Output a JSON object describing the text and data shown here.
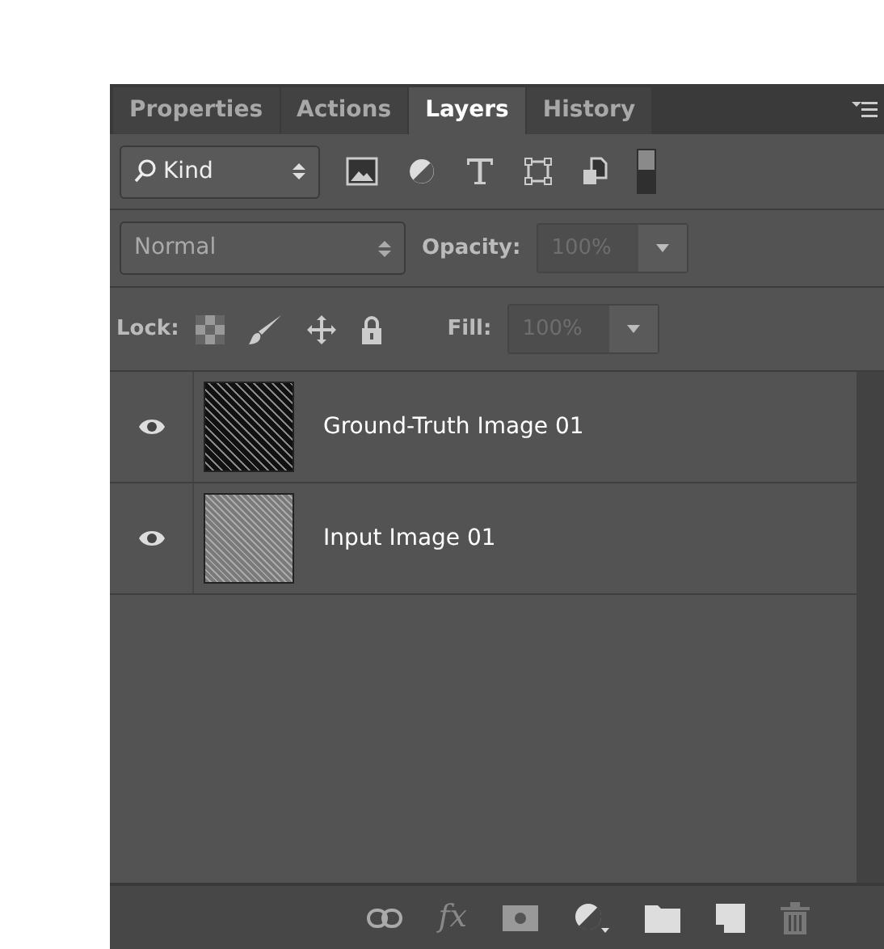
{
  "tabs": [
    {
      "label": "Properties",
      "selected": false
    },
    {
      "label": "Actions",
      "selected": false
    },
    {
      "label": "Layers",
      "selected": true
    },
    {
      "label": "History",
      "selected": false
    }
  ],
  "filter": {
    "value": "Kind"
  },
  "blend_mode": {
    "value": "Normal"
  },
  "opacity": {
    "label": "Opacity:",
    "value": "100%",
    "disabled": true
  },
  "lock": {
    "label": "Lock:"
  },
  "fill": {
    "label": "Fill:",
    "value": "100%",
    "disabled": true
  },
  "layers": [
    {
      "name": "Ground-Truth Image 01",
      "visible": true,
      "kind": "dark"
    },
    {
      "name": "Input Image 01",
      "visible": true,
      "kind": "light"
    }
  ],
  "footer": {
    "fx_label": "fx"
  }
}
